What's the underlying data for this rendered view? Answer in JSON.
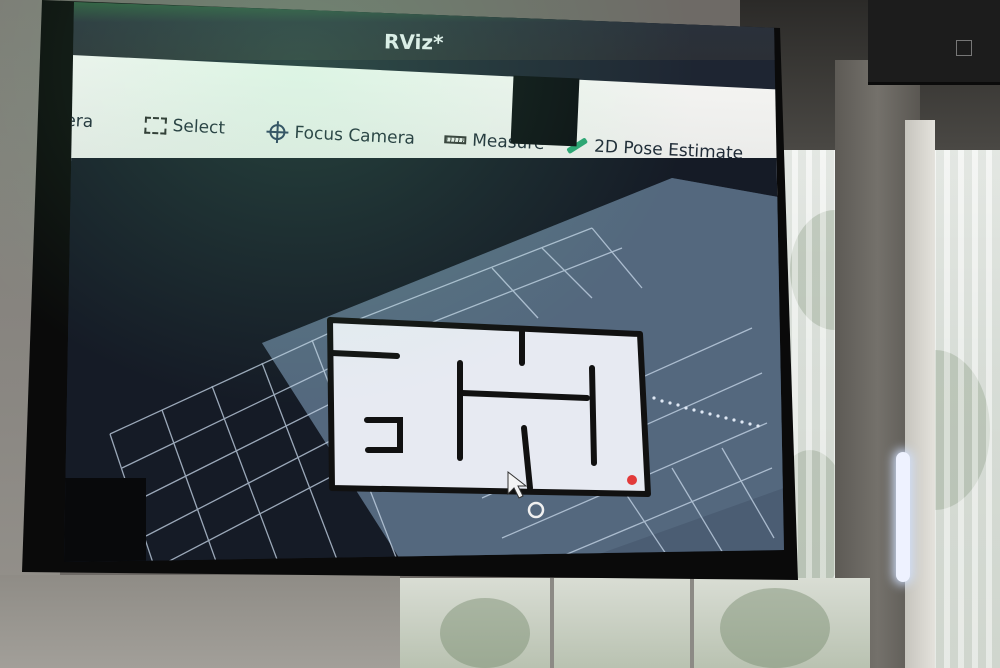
{
  "window": {
    "title": "RViz*"
  },
  "toolbar": {
    "items": [
      {
        "label": "mera",
        "icon": "camera-icon"
      },
      {
        "label": "Select",
        "icon": "select-box-icon"
      },
      {
        "label": "Focus Camera",
        "icon": "focus-crosshair-icon"
      },
      {
        "label": "Measure",
        "icon": "ruler-icon"
      },
      {
        "label": "2D Pose Estimate",
        "icon": "pose-arrow-icon"
      }
    ]
  },
  "viewport": {
    "content": "occupancy-grid-map",
    "grid_color": "#c8d8ea",
    "map_free_color": "#e7eaf2",
    "map_wall_color": "#111111",
    "background_color": "#1a2130"
  },
  "colors": {
    "title_bar": "#2b2f36",
    "toolbar_bg": "#efefed",
    "toolbar_text": "#1f2a36",
    "accent_pose": "#2aa372"
  }
}
